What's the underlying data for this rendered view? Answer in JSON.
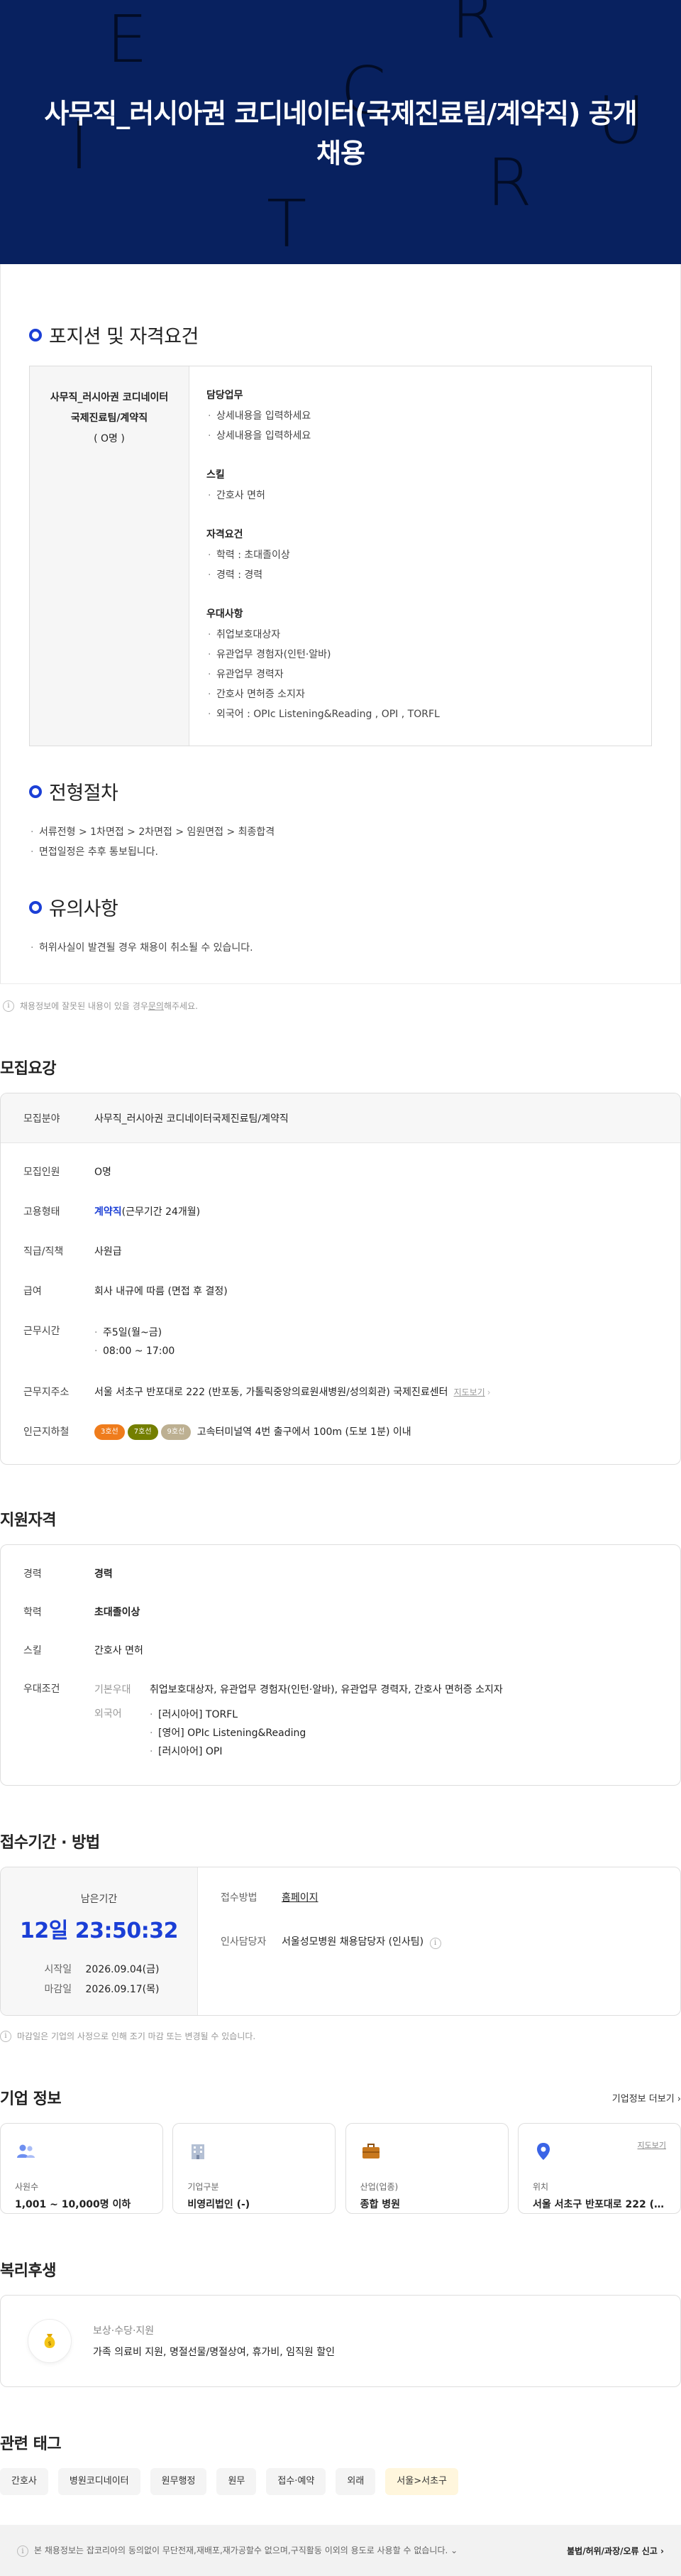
{
  "hero": {
    "title": "사무직_러시아권 코디네이터(국제진료팀/계약직) 공개채용",
    "deco_letters": [
      "E",
      "R",
      "C",
      "I",
      "U",
      "T",
      "R"
    ]
  },
  "posting": {
    "position_title": "포지션 및 자격요건",
    "position_name": "사무직_러시아권 코디네이터국제진료팀/계약직",
    "position_count": "( O명 )",
    "groups": [
      {
        "title": "담당업무",
        "items": [
          "상세내용을 입력하세요",
          "상세내용을 입력하세요"
        ]
      },
      {
        "title": "스킬",
        "items": [
          "간호사 면허"
        ]
      },
      {
        "title": "자격요건",
        "items": [
          "학력 : 초대졸이상",
          "경력 : 경력"
        ]
      },
      {
        "title": "우대사항",
        "items": [
          "취업보호대상자",
          "유관업무 경험자(인턴·알바)",
          "유관업무 경력자",
          "간호사 면허증 소지자",
          "외국어 : OPIc Listening&Reading , OPI , TORFL"
        ]
      }
    ],
    "process_title": "전형절차",
    "process_items": [
      "서류전형 > 1차면접 > 2차면접 > 임원면접 > 최종합격",
      "면접일정은 추후 통보됩니다."
    ],
    "caution_title": "유의사항",
    "caution_items": [
      "허위사실이 발견될 경우 채용이 취소될 수 있습니다."
    ]
  },
  "notice": {
    "text_before": "채용정보에 잘못된 내용이 있을 경우 ",
    "link": "문의",
    "text_after": "해주세요."
  },
  "mojip": {
    "title": "모집요강",
    "field_label": "모집분야",
    "field_value": "사무직_러시아권 코디네이터국제진료팀/계약직",
    "count_label": "모집인원",
    "count_value": "O명",
    "type_label": "고용형태",
    "type_value_strong": "계약직",
    "type_value_rest": "(근무기간 24개월)",
    "rank_label": "직급/직책",
    "rank_value": "사원급",
    "pay_label": "급여",
    "pay_value": "회사 내규에 따름 (면접 후 결정)",
    "time_label": "근무시간",
    "time_items": [
      "주5일(월~금)",
      "08:00 ~ 17:00"
    ],
    "addr_label": "근무지주소",
    "addr_value": "서울 서초구 반포대로 222 (반포동, 가톨릭중앙의료원새병원/성의회관) 국제진료센터",
    "addr_link": "지도보기",
    "subway_label": "인근지하철",
    "subway_chips": [
      {
        "label": "3호선",
        "color": "#ef7c1c"
      },
      {
        "label": "7호선",
        "color": "#747f00"
      },
      {
        "label": "9호선",
        "color": "#bdb092"
      }
    ],
    "subway_text": "고속터미널역 4번 출구에서 100m (도보 1분) 이내"
  },
  "jiwon": {
    "title": "지원자격",
    "career_label": "경력",
    "career_value": "경력",
    "edu_label": "학력",
    "edu_value": "초대졸이상",
    "skill_label": "스킬",
    "skill_value": "간호사 면허",
    "pref_label": "우대조건",
    "basic_label": "기본우대",
    "basic_value": "취업보호대상자, 유관업무 경험자(인턴·알바), 유관업무 경력자, 간호사 면허증 소지자",
    "lang_label": "외국어",
    "lang_items": [
      "[러시아어] TORFL",
      "[영어] OPIc Listening&Reading",
      "[러시아어] OPI"
    ]
  },
  "jeopsu": {
    "title": "접수기간 · 방법",
    "remain_label": "남은기간",
    "remain_value": "12일 23:50:32",
    "start_label": "시작일",
    "start_value": "2026.09.04(금)",
    "end_label": "마감일",
    "end_value": "2026.09.17(목)",
    "method_label": "접수방법",
    "method_value": "홈페이지",
    "manager_label": "인사담당자",
    "manager_value": "서울성모병원 채용담당자 (인사팀)",
    "notice": "마감일은 기업의 사정으로 인해 조기 마감 또는 변경될 수 있습니다."
  },
  "company": {
    "title": "기업 정보",
    "more": "기업정보 더보기",
    "cards": [
      {
        "label": "사원수",
        "value": "1,001 ~ 10,000명 이하",
        "icon": "people-icon",
        "color": "#6e8ff0"
      },
      {
        "label": "기업구분",
        "value": "비영리법인 (-)",
        "icon": "building-icon",
        "color": "#97a6c0"
      },
      {
        "label": "산업(업종)",
        "value": "종합 병원",
        "icon": "briefcase-icon",
        "color": "#c8781e"
      },
      {
        "label": "위치",
        "value": "서울 서초구 반포대로 222 (반포…",
        "icon": "location-pin-icon",
        "color": "#3b64e6",
        "link": "지도보기"
      }
    ]
  },
  "welfare": {
    "title": "복리후생",
    "category": "보상·수당·지원",
    "value": "가족 의료비 지원, 명절선물/명절상여, 휴가비, 임직원 할인",
    "icon": "money-bag-icon"
  },
  "tags": {
    "title": "관련 태그",
    "items": [
      "간호사",
      "병원코디네이터",
      "원무행정",
      "원무",
      "접수·예약",
      "외래",
      "서울>서초구"
    ]
  },
  "footer": {
    "left": "본 채용정보는 잡코리아의 동의없이 무단전재,재배포,재가공할수 없으며,구직활동 이외의 용도로 사용할 수 없습니다.",
    "right": "불법/허위/과장/오류 신고"
  }
}
